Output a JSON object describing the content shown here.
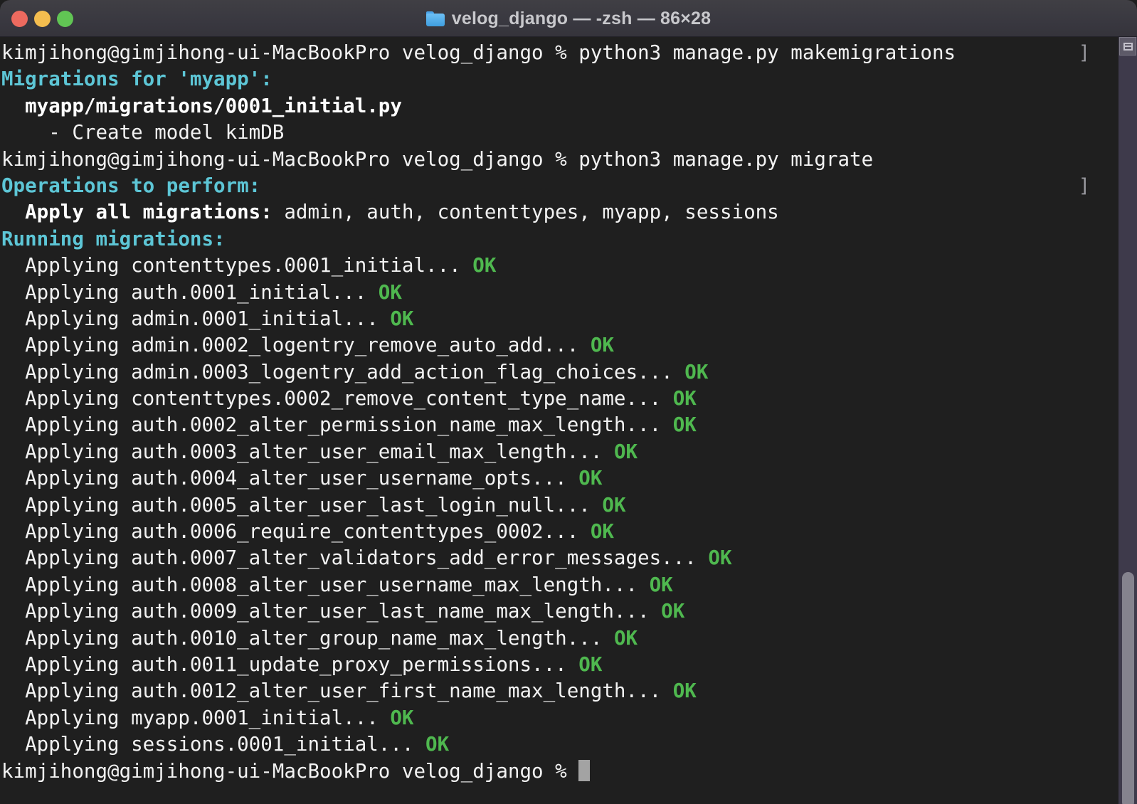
{
  "window": {
    "title": "velog_django — -zsh — 86×28",
    "folder_icon": "folder-icon",
    "controls": {
      "close": "close-button",
      "minimize": "minimize-button",
      "maximize": "maximize-button"
    },
    "colors": {
      "titlebar_bg": "#393840",
      "terminal_bg": "#1f1f1f",
      "foreground": "#f2f2f2",
      "cyan": "#5dc6d6",
      "green": "#4fb84f",
      "cursor": "#a3a3a3",
      "close": "#ed6a5f",
      "minimize": "#f4bd4f",
      "maximize": "#61c554",
      "scrollbar_track": "#3e3a4b",
      "scrollbar_thumb": "#85838e"
    }
  },
  "terminal": {
    "columns": 86,
    "rows": 28,
    "shell": "-zsh",
    "prompt_user": "kimjihong",
    "prompt_host": "gimjihong-ui-MacBookPro",
    "prompt_dir": "velog_django",
    "prompt_symbol": "%",
    "command_mark": "]",
    "lines": [
      {
        "mark": true,
        "segments": [
          {
            "t": "kimjihong@gimjihong-ui-MacBookPro velog_django % python3 manage.py makemigrations",
            "c": "plain"
          }
        ]
      },
      {
        "mark": false,
        "segments": [
          {
            "t": "Migrations for 'myapp':",
            "c": "cyan"
          }
        ]
      },
      {
        "mark": false,
        "segments": [
          {
            "t": "  myapp/migrations/0001_initial.py",
            "c": "bold"
          }
        ]
      },
      {
        "mark": false,
        "segments": [
          {
            "t": "    - Create model kimDB",
            "c": "plain"
          }
        ]
      },
      {
        "mark": false,
        "segments": [
          {
            "t": "kimjihong@gimjihong-ui-MacBookPro velog_django % python3 manage.py migrate",
            "c": "plain"
          }
        ]
      },
      {
        "mark": true,
        "segments": [
          {
            "t": "Operations to perform:",
            "c": "cyan"
          }
        ]
      },
      {
        "mark": false,
        "segments": [
          {
            "t": "  Apply all migrations:",
            "c": "bold"
          },
          {
            "t": " admin, auth, contenttypes, myapp, sessions",
            "c": "plain"
          }
        ]
      },
      {
        "mark": false,
        "segments": [
          {
            "t": "Running migrations:",
            "c": "cyan"
          }
        ]
      },
      {
        "mark": false,
        "segments": [
          {
            "t": "  Applying contenttypes.0001_initial...",
            "c": "plain"
          },
          {
            "t": " OK",
            "c": "green"
          }
        ]
      },
      {
        "mark": false,
        "segments": [
          {
            "t": "  Applying auth.0001_initial...",
            "c": "plain"
          },
          {
            "t": " OK",
            "c": "green"
          }
        ]
      },
      {
        "mark": false,
        "segments": [
          {
            "t": "  Applying admin.0001_initial...",
            "c": "plain"
          },
          {
            "t": " OK",
            "c": "green"
          }
        ]
      },
      {
        "mark": false,
        "segments": [
          {
            "t": "  Applying admin.0002_logentry_remove_auto_add...",
            "c": "plain"
          },
          {
            "t": " OK",
            "c": "green"
          }
        ]
      },
      {
        "mark": false,
        "segments": [
          {
            "t": "  Applying admin.0003_logentry_add_action_flag_choices...",
            "c": "plain"
          },
          {
            "t": " OK",
            "c": "green"
          }
        ]
      },
      {
        "mark": false,
        "segments": [
          {
            "t": "  Applying contenttypes.0002_remove_content_type_name...",
            "c": "plain"
          },
          {
            "t": " OK",
            "c": "green"
          }
        ]
      },
      {
        "mark": false,
        "segments": [
          {
            "t": "  Applying auth.0002_alter_permission_name_max_length...",
            "c": "plain"
          },
          {
            "t": " OK",
            "c": "green"
          }
        ]
      },
      {
        "mark": false,
        "segments": [
          {
            "t": "  Applying auth.0003_alter_user_email_max_length...",
            "c": "plain"
          },
          {
            "t": " OK",
            "c": "green"
          }
        ]
      },
      {
        "mark": false,
        "segments": [
          {
            "t": "  Applying auth.0004_alter_user_username_opts...",
            "c": "plain"
          },
          {
            "t": " OK",
            "c": "green"
          }
        ]
      },
      {
        "mark": false,
        "segments": [
          {
            "t": "  Applying auth.0005_alter_user_last_login_null...",
            "c": "plain"
          },
          {
            "t": " OK",
            "c": "green"
          }
        ]
      },
      {
        "mark": false,
        "segments": [
          {
            "t": "  Applying auth.0006_require_contenttypes_0002...",
            "c": "plain"
          },
          {
            "t": " OK",
            "c": "green"
          }
        ]
      },
      {
        "mark": false,
        "segments": [
          {
            "t": "  Applying auth.0007_alter_validators_add_error_messages...",
            "c": "plain"
          },
          {
            "t": " OK",
            "c": "green"
          }
        ]
      },
      {
        "mark": false,
        "segments": [
          {
            "t": "  Applying auth.0008_alter_user_username_max_length...",
            "c": "plain"
          },
          {
            "t": " OK",
            "c": "green"
          }
        ]
      },
      {
        "mark": false,
        "segments": [
          {
            "t": "  Applying auth.0009_alter_user_last_name_max_length...",
            "c": "plain"
          },
          {
            "t": " OK",
            "c": "green"
          }
        ]
      },
      {
        "mark": false,
        "segments": [
          {
            "t": "  Applying auth.0010_alter_group_name_max_length...",
            "c": "plain"
          },
          {
            "t": " OK",
            "c": "green"
          }
        ]
      },
      {
        "mark": false,
        "segments": [
          {
            "t": "  Applying auth.0011_update_proxy_permissions...",
            "c": "plain"
          },
          {
            "t": " OK",
            "c": "green"
          }
        ]
      },
      {
        "mark": false,
        "segments": [
          {
            "t": "  Applying auth.0012_alter_user_first_name_max_length...",
            "c": "plain"
          },
          {
            "t": " OK",
            "c": "green"
          }
        ]
      },
      {
        "mark": false,
        "segments": [
          {
            "t": "  Applying myapp.0001_initial...",
            "c": "plain"
          },
          {
            "t": " OK",
            "c": "green"
          }
        ]
      },
      {
        "mark": false,
        "segments": [
          {
            "t": "  Applying sessions.0001_initial...",
            "c": "plain"
          },
          {
            "t": " OK",
            "c": "green"
          }
        ]
      },
      {
        "mark": false,
        "cursor": true,
        "segments": [
          {
            "t": "kimjihong@gimjihong-ui-MacBookPro velog_django % ",
            "c": "plain"
          }
        ]
      }
    ]
  },
  "scrollbar": {
    "marker_icon": "list-marker-icon"
  }
}
